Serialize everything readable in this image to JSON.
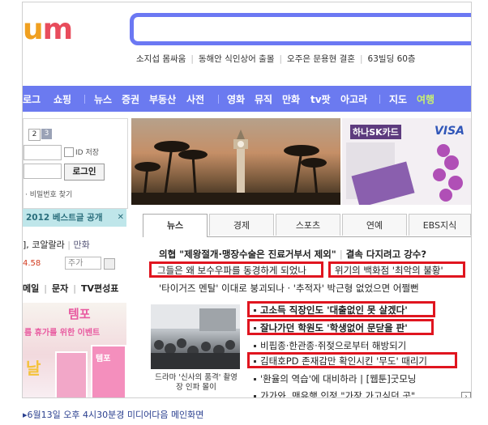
{
  "header": {
    "logo_part_1": "u",
    "logo_part_2": "m",
    "hot_keywords": [
      "소지섭 몸싸움",
      "동해안 식인상어 출몰",
      "오주은 문용현 결혼",
      "63빌딩 60층"
    ]
  },
  "nav": {
    "items": [
      "로그",
      "쇼핑",
      "뉴스",
      "증권",
      "부동산",
      "사전",
      "영화",
      "뮤직",
      "만화",
      "tv팟",
      "아고라",
      "지도",
      "여행"
    ]
  },
  "login": {
    "tabs": [
      "2",
      "3"
    ],
    "id_label": "일",
    "id_save_label": "ID 저장",
    "pw_label": "호",
    "login_button": "로그인",
    "find_links": "· 비밀번호 찾기"
  },
  "banner": {
    "text": "2012 베스트글 공개",
    "close": "✕"
  },
  "stock": {
    "row1_name": "], 코알랄라",
    "row1_link": "만화",
    "row2_value": "4.58",
    "input_placeholder": "주가"
  },
  "services": {
    "items": [
      "메일",
      "문자",
      "TV편성표"
    ]
  },
  "promo": {
    "brand": "템포",
    "text": "름 휴가를 위한 이벤트",
    "sale": "날",
    "box_brand": "템포"
  },
  "photos": {
    "right_brand": "하나SK카드",
    "right_visa": "VISA"
  },
  "news": {
    "tabs": [
      "뉴스",
      "경제",
      "스포츠",
      "연예",
      "EBS지식"
    ],
    "top_headline_a": "의협 \"제왕절개·맹장수술은 진료거부서 제외\"",
    "top_headline_b": "결속 다지려고 강수?",
    "line2_a": "그들은 왜 보수우파를 동경하게 되었나",
    "line2_b": "위기의 백화점 '최악의 불황'",
    "line3": "'타이거즈 멘탈' 이대로 붕괴되나 · '추적자' 박근형 없었으면 어쩔뻔",
    "list": [
      "고소득 직장인도 '대출없인 못 살겠다'",
      "잘나가던 학원도 '학생없어 문닫을 판'",
      "비핍종·한관종·쥐젖으로부터 해방되기",
      "김태호PD 존재감만 확인시킨 '무도' 때리기",
      "'환율의 역습'에 대비하라 | [웹툰]굿모닝",
      "가가와, 맨유행 인정 \"가장 가고싶던 곳\""
    ],
    "photo_caption": "드라마 '신사의 품격' 촬영장 인파 몰이",
    "pager": "›"
  },
  "caption": "▸6월13일 오후 4시30분경 미디어다음 메인화면"
}
